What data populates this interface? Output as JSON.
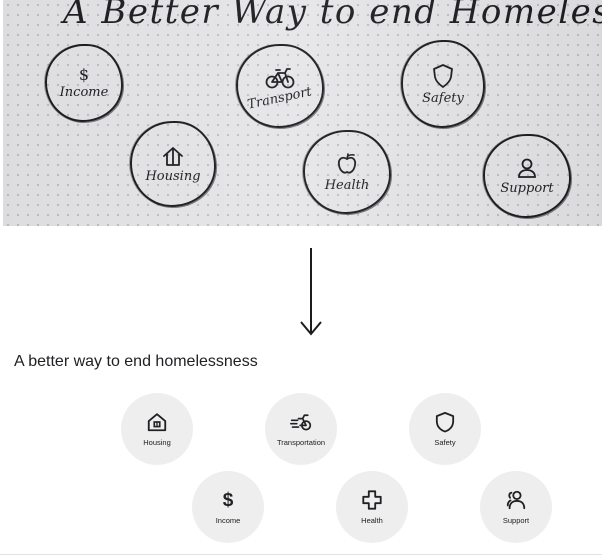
{
  "sketch": {
    "title": "A Better Way to end Homelessness",
    "items": [
      {
        "label": "Income",
        "glyph": "$",
        "icon": "dollar-icon"
      },
      {
        "label": "Transport",
        "icon": "bicycle-icon"
      },
      {
        "label": "Safety",
        "icon": "shield-icon"
      },
      {
        "label": "Housing",
        "icon": "house-icon"
      },
      {
        "label": "Health",
        "icon": "apple-icon"
      },
      {
        "label": "Support",
        "icon": "person-icon"
      }
    ]
  },
  "ui": {
    "title": "A better way to end homelessness",
    "cards": [
      {
        "label": "Housing",
        "icon": "house-icon"
      },
      {
        "label": "Transportation",
        "icon": "bicycle-icon"
      },
      {
        "label": "Safety",
        "icon": "shield-icon"
      },
      {
        "label": "Income",
        "glyph": "$",
        "icon": "dollar-icon"
      },
      {
        "label": "Health",
        "icon": "medical-cross-icon"
      },
      {
        "label": "Support",
        "icon": "people-icon"
      }
    ]
  },
  "colors": {
    "card_background": "#eeeeee",
    "text": "#202124",
    "ink": "#1d1d22",
    "paper": "#e6e6e8"
  }
}
